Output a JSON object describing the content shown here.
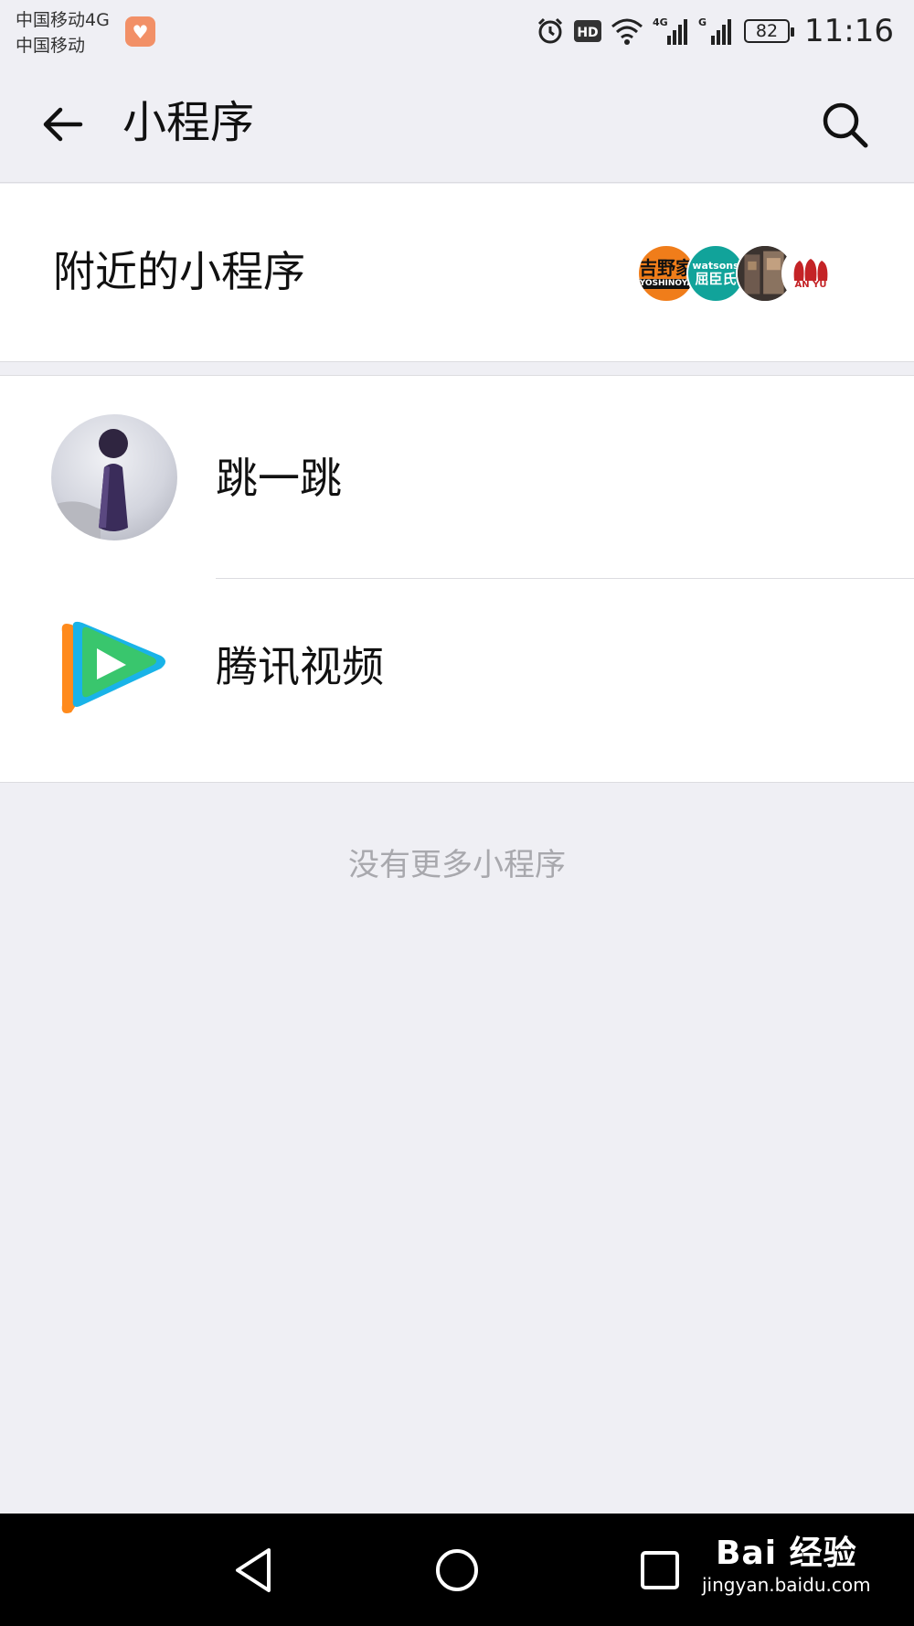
{
  "status_bar": {
    "carrier_1": "中国移动4G",
    "carrier_2": "中国移动",
    "battery": "82",
    "time": "11:16",
    "icons": [
      "health-app-icon",
      "alarm-icon",
      "hd-icon",
      "wifi-icon",
      "signal-4g-icon",
      "signal-g-icon",
      "battery-icon"
    ]
  },
  "header": {
    "title": "小程序",
    "back_icon": "arrow-left-icon",
    "search_icon": "search-icon"
  },
  "nearby": {
    "label": "附近的小程序",
    "avatar_texts": [
      "吉野家",
      "YOSHINOYA",
      "watsons",
      "屈臣氏",
      "AN YU"
    ]
  },
  "mini_programs": [
    {
      "label": "跳一跳",
      "icon": "jump-game-icon"
    },
    {
      "label": "腾讯视频",
      "icon": "tencent-video-icon"
    }
  ],
  "footer_note": "没有更多小程序",
  "system_nav": {
    "icons": [
      "nav-back-icon",
      "nav-home-icon",
      "nav-recents-icon"
    ]
  },
  "watermark": {
    "brand": "Bai 经验",
    "url": "jingyan.baidu.com"
  }
}
